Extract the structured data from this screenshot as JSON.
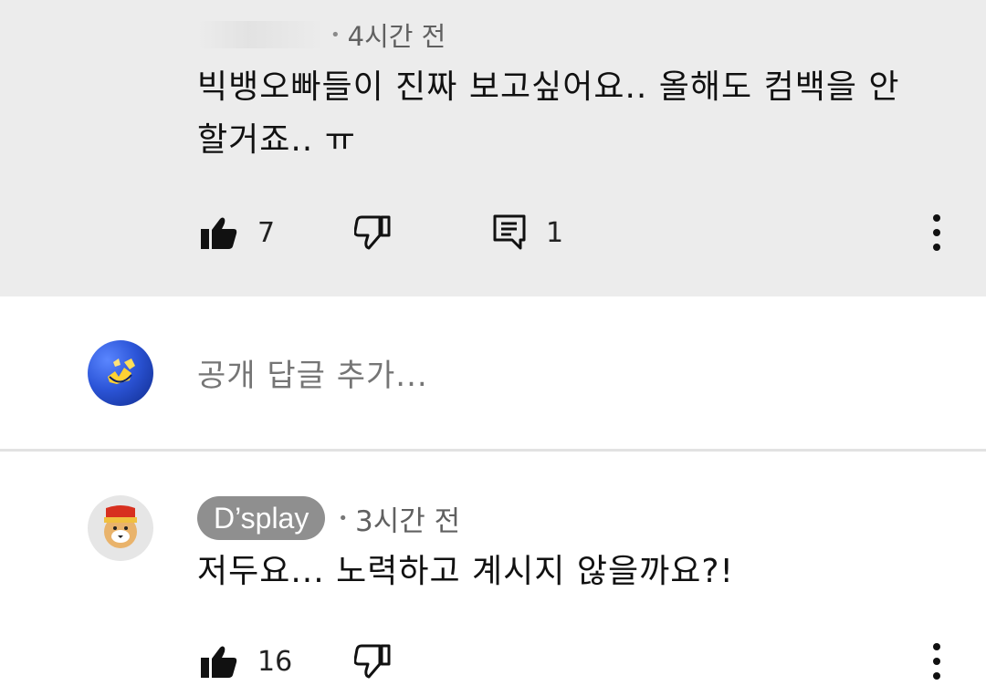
{
  "comment1": {
    "time": "4시간 전",
    "text_line1": "빅뱅오빠들이 진짜 보고싶어요.. 올해도 컴백을 안",
    "text_line2": "할거죠.. ㅠ",
    "likes": "7",
    "replies": "1"
  },
  "reply_box": {
    "placeholder": "공개 답글 추가..."
  },
  "comment2": {
    "author": "D’splay",
    "time": "3시간 전",
    "text": "저두요... 노력하고 계시지 않을까요?!",
    "likes": "16"
  },
  "colors": {
    "highlight_bg": "#ececec",
    "author_chip": "#8f8f8f",
    "divider": "#e2e2e2"
  },
  "icons": [
    "like-icon",
    "dislike-icon",
    "reply-icon",
    "more-vert-icon"
  ]
}
